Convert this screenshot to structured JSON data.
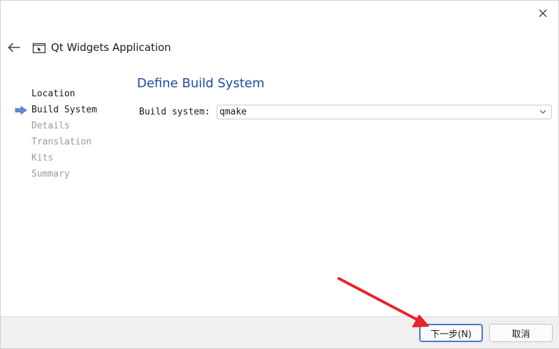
{
  "window": {
    "title": "Qt Widgets Application"
  },
  "steps": [
    {
      "label": "Location",
      "state": "done"
    },
    {
      "label": "Build System",
      "state": "current"
    },
    {
      "label": "Details",
      "state": "pending"
    },
    {
      "label": "Translation",
      "state": "pending"
    },
    {
      "label": "Kits",
      "state": "pending"
    },
    {
      "label": "Summary",
      "state": "pending"
    }
  ],
  "page": {
    "title": "Define Build System",
    "build_system_label": "Build system:",
    "build_system_value": "qmake"
  },
  "footer": {
    "next_label": "下一步(N)",
    "cancel_label": "取消"
  },
  "colors": {
    "accent": "#1e4a9c",
    "annotation_arrow": "#e8232a",
    "current_step_arrow": "#5b8fd6"
  },
  "icons": {
    "close": "close-icon",
    "back": "back-arrow-icon",
    "app": "qt-app-icon",
    "current_step": "current-step-arrow-icon",
    "dropdown": "chevron-down-icon"
  }
}
